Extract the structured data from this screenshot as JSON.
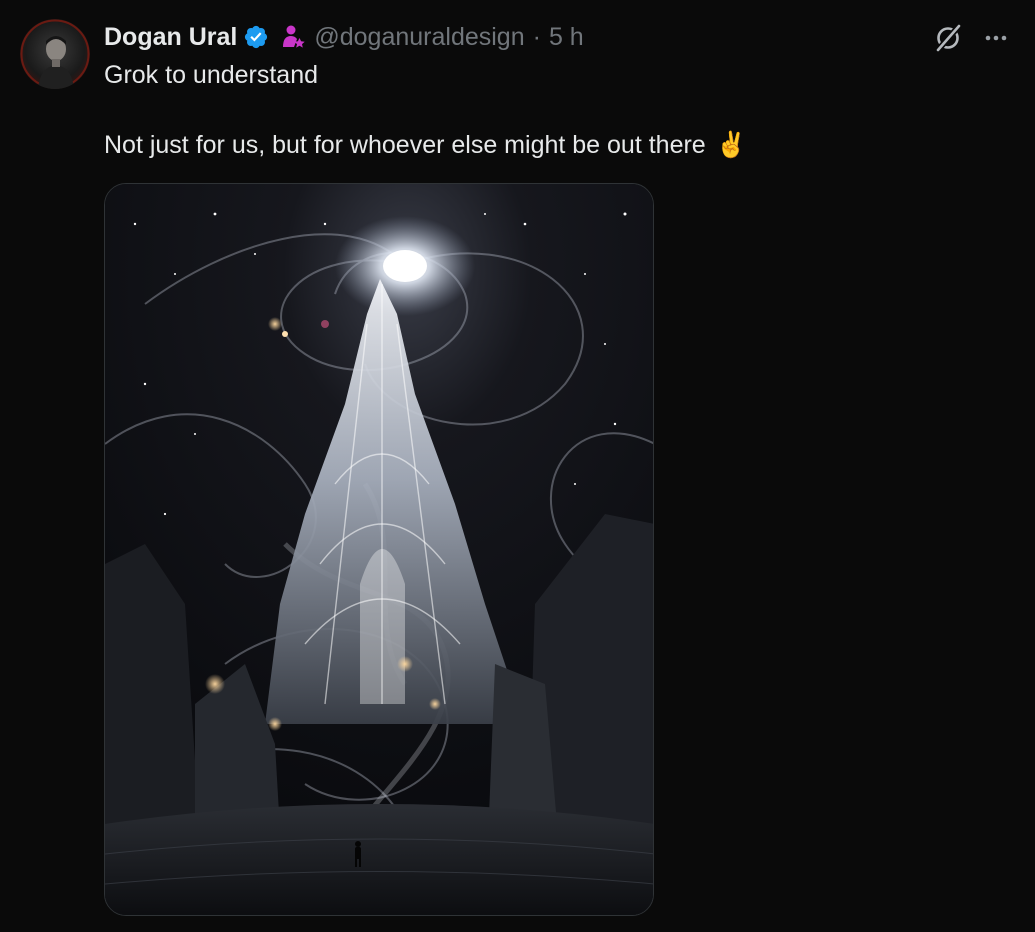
{
  "tweet": {
    "author": {
      "display_name": "Dogan Ural",
      "handle": "@doganuraldesign",
      "verified": true,
      "avatar_icon": "profile-photo",
      "affiliate_icon": "person-star-icon"
    },
    "separator": "·",
    "time": "5 h",
    "text_line1": "Grok to understand",
    "text_line2": "Not just for us, but for whoever else might be out there",
    "emoji": "✌️",
    "actions": {
      "grok_icon": "grok-icon",
      "more_icon": "more-horizontal-icon"
    },
    "media": {
      "kind": "image",
      "subject": "cosmic cathedral"
    },
    "colors": {
      "background": "#0a0a0a",
      "text": "#e7e9ea",
      "muted": "#71767b",
      "verified": "#1d9bf0",
      "affiliate": "#c936c9"
    }
  }
}
